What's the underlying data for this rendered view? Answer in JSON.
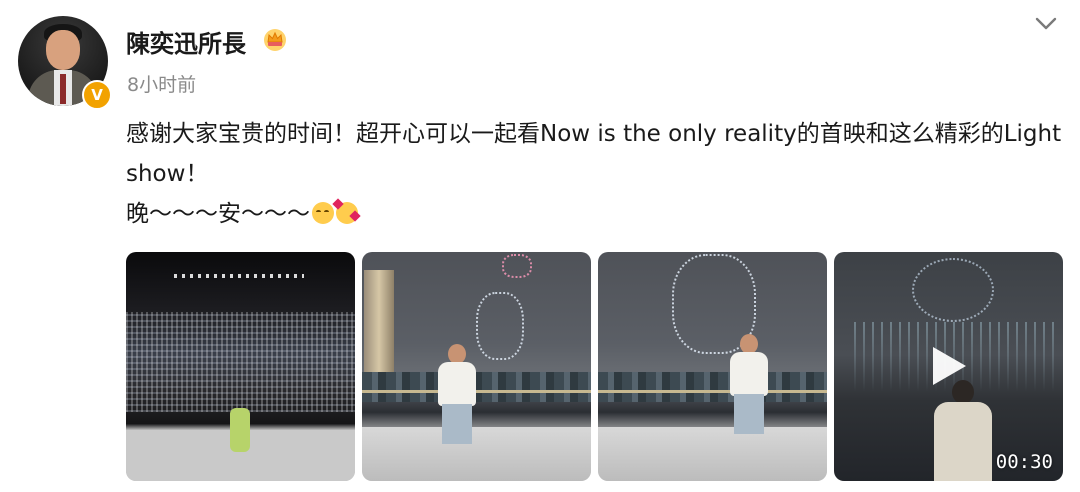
{
  "post": {
    "author": {
      "name": "陳奕迅所長",
      "verified_badge": "V",
      "badge_icon": "crown-icon"
    },
    "timestamp": "8小时前",
    "menu_icon": "chevron-down-icon",
    "content": {
      "line1": "感谢大家宝贵的时间！超开心可以一起看Now is the only reality的首映和这么精彩的Light show！",
      "line2": "晚～～～安～～～",
      "emojis": [
        "relieved-face",
        "smiling-face-with-hearts"
      ]
    },
    "media": [
      {
        "type": "photo",
        "subject": "arena-stage"
      },
      {
        "type": "photo",
        "subject": "drone-show-balloon"
      },
      {
        "type": "photo",
        "subject": "drone-show-portrait"
      },
      {
        "type": "video",
        "subject": "drone-show-video",
        "duration": "00:30"
      }
    ]
  }
}
